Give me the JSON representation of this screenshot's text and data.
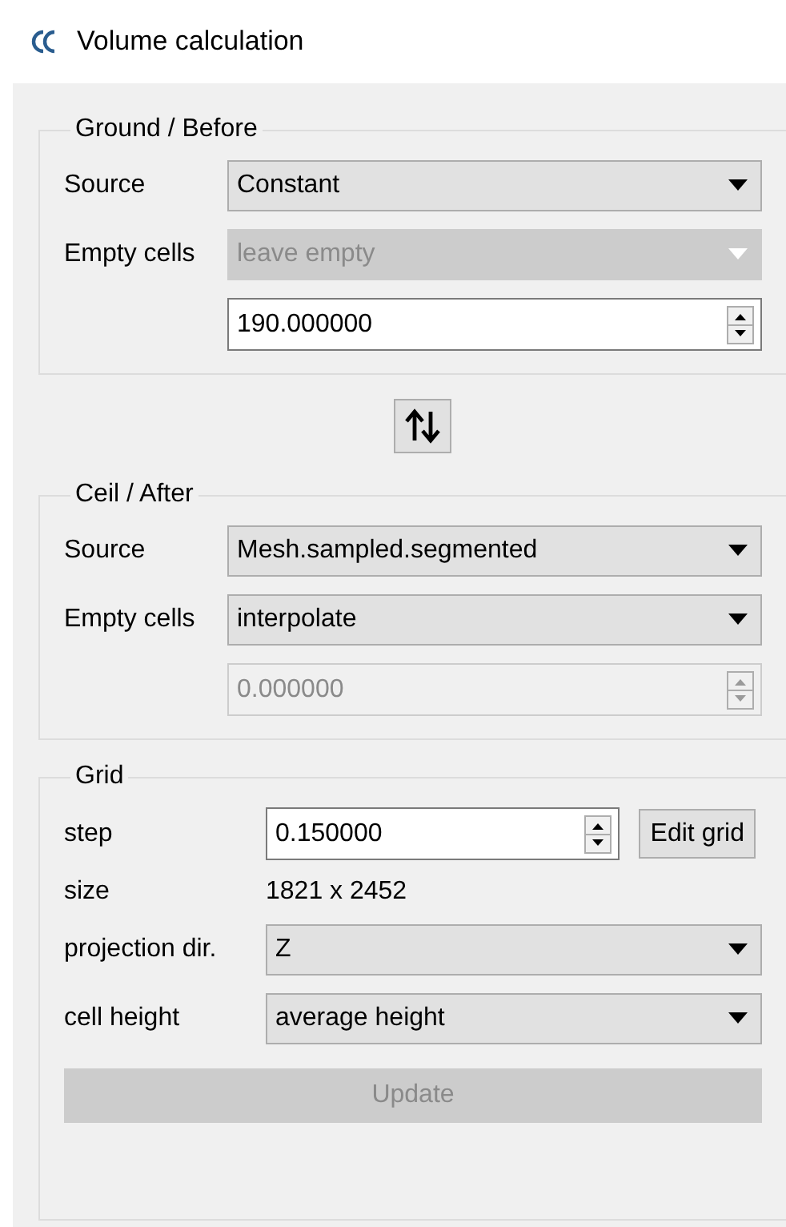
{
  "window": {
    "title": "Volume calculation"
  },
  "ground": {
    "title": "Ground / Before",
    "rows": [
      {
        "kind": "combo",
        "label": "Source",
        "value": "Constant",
        "disabled": false
      },
      {
        "kind": "combo",
        "label": "Empty cells",
        "value": "leave empty",
        "disabled": true
      },
      {
        "kind": "spin",
        "value": "190.000000",
        "disabled": false
      }
    ]
  },
  "ceil": {
    "title": "Ceil / After",
    "rows": [
      {
        "kind": "combo",
        "label": "Source",
        "value": "Mesh.sampled.segmented",
        "disabled": false
      },
      {
        "kind": "combo",
        "label": "Empty cells",
        "value": "interpolate",
        "disabled": false
      },
      {
        "kind": "spin",
        "value": "0.000000",
        "disabled": true
      }
    ]
  },
  "grid": {
    "title": "Grid",
    "rows": [
      {
        "kind": "spin",
        "label": "step",
        "value": "0.150000",
        "disabled": false,
        "button": "Edit grid"
      },
      {
        "kind": "text",
        "label": "size",
        "value": "1821 x 2452"
      },
      {
        "kind": "combo",
        "label": "projection dir.",
        "value": "Z",
        "disabled": false
      },
      {
        "kind": "combo",
        "label": "cell height",
        "value": "average height",
        "disabled": false
      },
      {
        "kind": "button",
        "label": "Update",
        "disabled": true
      }
    ]
  }
}
